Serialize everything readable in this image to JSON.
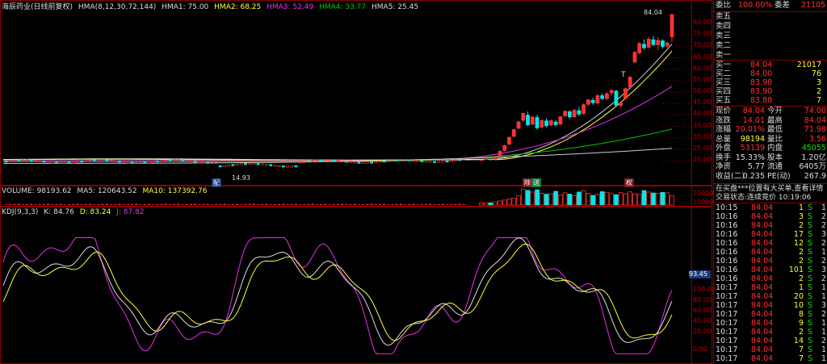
{
  "price_header": {
    "name": "海辰药业(日线前复权)",
    "hma": "HMA(8,12,30,72,144)",
    "hma1": "HMA1: 75.00",
    "hma2": "HMA2: 68.25",
    "hma3": "HMA3: 52.49",
    "hma4": "HMA4: 33.77",
    "hma5": "HMA5: 25.45",
    "colors": {
      "hma1": "#dddddd",
      "hma2": "#ffff3c",
      "hma3": "#e632e6",
      "hma4": "#00c800",
      "hma5": "#dddddd"
    }
  },
  "volume_header": {
    "vol": "VOLUME: 98193.62",
    "ma5": "MA5: 120643.52",
    "ma10": "MA10: 137392.76"
  },
  "kdj_header": {
    "title": "KDJ(9,3,3)",
    "k": "K: 84.76",
    "d": "D: 83.24",
    "j": "J: 87.82"
  },
  "price_axis": [
    "80.00",
    "75.00",
    "70.00",
    "65.00",
    "60.00",
    "55.00",
    "50.00",
    "45.00",
    "40.00",
    "35.00",
    "30.00",
    "25.00",
    "20.00"
  ],
  "volume_axis": [
    "20000",
    "10000"
  ],
  "kdj_axis": [
    "93.45",
    "100.00",
    "80.00",
    "60.00",
    "40.00",
    "20.00",
    "0.00"
  ],
  "annotations": {
    "high": "84.04",
    "low": "14.93",
    "marker": "T"
  },
  "markers": [
    "配",
    "除",
    "送",
    "权"
  ],
  "order_book": {
    "weibi_label": "委比",
    "weibi": "100.00%",
    "weicha_label": "委差",
    "weicha": "21105",
    "sells": [
      {
        "label": "卖五",
        "price": "",
        "vol": ""
      },
      {
        "label": "卖四",
        "price": "",
        "vol": ""
      },
      {
        "label": "卖三",
        "price": "",
        "vol": ""
      },
      {
        "label": "卖二",
        "price": "",
        "vol": ""
      },
      {
        "label": "卖一",
        "price": "",
        "vol": ""
      }
    ],
    "buys": [
      {
        "label": "买一",
        "price": "84.04",
        "vol": "21017"
      },
      {
        "label": "买二",
        "price": "84.00",
        "vol": "76"
      },
      {
        "label": "买三",
        "price": "83.98",
        "vol": "3"
      },
      {
        "label": "买四",
        "price": "83.90",
        "vol": "2"
      },
      {
        "label": "买五",
        "price": "83.88",
        "vol": "7"
      }
    ]
  },
  "quote": [
    {
      "l1": "现价",
      "v1": "84.04",
      "c1": "red",
      "l2": "今开",
      "v2": "74.00",
      "c2": "red"
    },
    {
      "l1": "涨跌",
      "v1": "14.01",
      "c1": "red",
      "l2": "最高",
      "v2": "84.04",
      "c2": "red"
    },
    {
      "l1": "涨幅",
      "v1": "20.01%",
      "c1": "red",
      "l2": "最低",
      "v2": "71.98",
      "c2": "red"
    },
    {
      "l1": "总量",
      "v1": "98194",
      "c1": "yel",
      "l2": "量比",
      "v2": "3.56",
      "c2": "red"
    },
    {
      "l1": "外盘",
      "v1": "53139",
      "c1": "red",
      "l2": "内盘",
      "v2": "45055",
      "c2": "grn"
    },
    {
      "l1": "换手",
      "v1": "15.33%",
      "c1": "wht",
      "l2": "股本",
      "v2": "1.20亿",
      "c2": "wht"
    },
    {
      "l1": "净资",
      "v1": "5.77",
      "c1": "wht",
      "l2": "流通",
      "v2": "6405万",
      "c2": "wht"
    },
    {
      "l1": "收益(二)",
      "v1": "0.235",
      "c1": "wht",
      "l2": "PE(动)",
      "v2": "267.9",
      "c2": "wht"
    }
  ],
  "notice": "在买盘***位置有大买单,查看详情",
  "status": "交易状态:连续竞价 10:19:06",
  "ticks": [
    {
      "t": "10:15",
      "p": "84.04",
      "v": "1",
      "f": "S",
      "n": "1"
    },
    {
      "t": "10:16",
      "p": "84.04",
      "v": "3",
      "f": "S",
      "n": "2"
    },
    {
      "t": "10:16",
      "p": "84.04",
      "v": "2",
      "f": "S",
      "n": "2"
    },
    {
      "t": "10:16",
      "p": "84.04",
      "v": "17",
      "f": "S",
      "n": "3"
    },
    {
      "t": "10:16",
      "p": "84.04",
      "v": "12",
      "f": "S",
      "n": "2"
    },
    {
      "t": "10:16",
      "p": "84.04",
      "v": "2",
      "f": "S",
      "n": "1"
    },
    {
      "t": "10:16",
      "p": "84.04",
      "v": "2",
      "f": "S",
      "n": "2"
    },
    {
      "t": "10:16",
      "p": "84.04",
      "v": "101",
      "f": "S",
      "n": "3"
    },
    {
      "t": "10:16",
      "p": "84.04",
      "v": "2",
      "f": "S",
      "n": "2"
    },
    {
      "t": "10:17",
      "p": "84.04",
      "v": "1",
      "f": "S",
      "n": "1"
    },
    {
      "t": "10:17",
      "p": "84.04",
      "v": "20",
      "f": "S",
      "n": "1"
    },
    {
      "t": "10:17",
      "p": "84.04",
      "v": "10",
      "f": "S",
      "n": "3"
    },
    {
      "t": "10:17",
      "p": "84.04",
      "v": "8",
      "f": "S",
      "n": "2"
    },
    {
      "t": "10:17",
      "p": "84.04",
      "v": "9",
      "f": "S",
      "n": "1"
    },
    {
      "t": "10:17",
      "p": "84.04",
      "v": "2",
      "f": "S",
      "n": "1"
    },
    {
      "t": "10:17",
      "p": "84.04",
      "v": "14",
      "f": "S",
      "n": "2"
    },
    {
      "t": "10:17",
      "p": "84.04",
      "v": "7",
      "f": "S",
      "n": "1"
    },
    {
      "t": "10:17",
      "p": "84.04",
      "v": "7",
      "f": "S",
      "n": "1"
    }
  ],
  "chart_data": [
    {
      "type": "candlestick",
      "note": "daily candles, recent sequence (open, high, low, close)",
      "ylim": [
        14,
        86
      ],
      "candles": [
        [
          20.2,
          20.5,
          19.9,
          20.3
        ],
        [
          20.4,
          21.0,
          20.2,
          20.8
        ],
        [
          20.6,
          20.9,
          20.1,
          20.4
        ],
        [
          20.5,
          22.0,
          20.4,
          21.8
        ],
        [
          21.9,
          24.5,
          21.7,
          24.2
        ],
        [
          24.3,
          27.0,
          24.0,
          26.7
        ],
        [
          27.0,
          30.5,
          26.9,
          30.3
        ],
        [
          30.5,
          34.0,
          30.2,
          33.7
        ],
        [
          34.0,
          37.5,
          33.8,
          37.1
        ],
        [
          37.5,
          41.0,
          37.0,
          40.8
        ],
        [
          40.0,
          41.5,
          35.0,
          35.5
        ],
        [
          35.8,
          39.5,
          35.5,
          39.2
        ],
        [
          39.0,
          40.0,
          33.5,
          34.2
        ],
        [
          34.5,
          38.0,
          34.0,
          37.7
        ],
        [
          37.5,
          38.5,
          34.5,
          35.1
        ],
        [
          35.5,
          38.0,
          35.0,
          37.6
        ],
        [
          37.0,
          37.8,
          35.0,
          35.6
        ],
        [
          35.8,
          39.5,
          35.5,
          39.3
        ],
        [
          39.5,
          42.0,
          39.0,
          41.7
        ],
        [
          41.5,
          42.0,
          38.5,
          39.0
        ],
        [
          39.0,
          42.5,
          38.8,
          42.2
        ],
        [
          42.0,
          43.5,
          39.5,
          40.2
        ],
        [
          40.5,
          45.0,
          40.0,
          44.6
        ],
        [
          44.5,
          47.0,
          44.0,
          46.7
        ],
        [
          46.5,
          47.5,
          44.5,
          45.2
        ],
        [
          45.0,
          49.0,
          44.8,
          48.5
        ],
        [
          48.5,
          49.5,
          46.5,
          47.0
        ],
        [
          47.0,
          50.0,
          46.5,
          49.4
        ],
        [
          49.5,
          51.5,
          48.5,
          50.8
        ],
        [
          50.5,
          51.0,
          43.5,
          44.0
        ],
        [
          44.0,
          46.0,
          43.0,
          45.5
        ],
        [
          47.0,
          52.0,
          46.8,
          51.6
        ],
        [
          52.0,
          57.0,
          51.8,
          56.6
        ],
        [
          63.0,
          68.0,
          62.5,
          67.5
        ],
        [
          67.0,
          72.0,
          66.5,
          71.4
        ],
        [
          71.0,
          73.0,
          68.5,
          69.2
        ],
        [
          69.5,
          74.0,
          69.0,
          73.3
        ],
        [
          73.0,
          74.5,
          70.0,
          70.6
        ],
        [
          70.5,
          74.0,
          68.5,
          72.7
        ],
        [
          72.5,
          73.0,
          69.0,
          69.8
        ],
        [
          70.0,
          72.0,
          68.0,
          71.6
        ],
        [
          74.0,
          84.04,
          71.98,
          84.04
        ]
      ]
    },
    {
      "type": "bar",
      "name": "VOLUME",
      "values": [
        2800,
        3100,
        2900,
        4300,
        5600,
        6700,
        8200,
        9000,
        12500,
        21500,
        19800,
        17500,
        20500,
        16000,
        14500,
        15200,
        18500,
        13500,
        16500,
        14800,
        12500,
        17500,
        19500,
        15800,
        13000,
        14500,
        18000,
        17200,
        15500,
        13800,
        16800,
        15200,
        17800,
        15000,
        14200,
        19500,
        17500,
        16200,
        15800,
        17000,
        16500,
        12600
      ]
    },
    {
      "type": "line",
      "name": "KDJ",
      "ylim": [
        0,
        100
      ]
    }
  ]
}
